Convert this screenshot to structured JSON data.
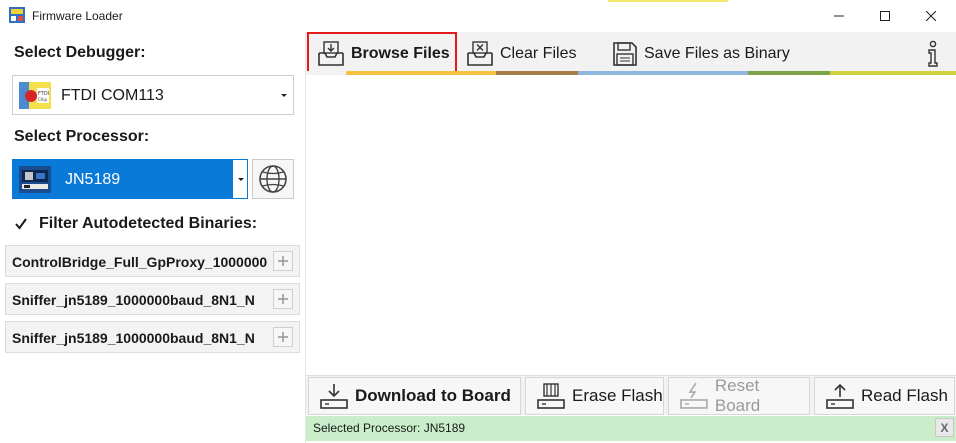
{
  "window": {
    "title": "Firmware Loader",
    "icon": "firmware-loader-app-icon"
  },
  "left": {
    "debugger_label": "Select Debugger:",
    "debugger_value": "FTDI COM113",
    "processor_label": "Select Processor:",
    "processor_value": "JN5189",
    "filter_label": "Filter Autodetected Binaries:",
    "filter_checked": true,
    "binaries": [
      {
        "name": "ControlBridge_Full_GpProxy_1000000"
      },
      {
        "name": "Sniffer_jn5189_1000000baud_8N1_N"
      },
      {
        "name": "Sniffer_jn5189_1000000baud_8N1_N"
      }
    ]
  },
  "toolbar": {
    "browse_label": "Browse Files",
    "clear_label": "Clear Files",
    "save_label": "Save Files as Binary",
    "stripe_colors": [
      "#f5c242",
      "#a57c44",
      "#8fb7de",
      "#7ea349",
      "#cfd23e"
    ]
  },
  "actions": {
    "download_label": "Download to Board",
    "erase_label": "Erase Flash",
    "reset_label": "Reset Board",
    "reset_enabled": false,
    "read_label": "Read Flash"
  },
  "status": {
    "text": "Selected Processor: JN5189",
    "close_label": "X",
    "color": "#c9eec9"
  }
}
